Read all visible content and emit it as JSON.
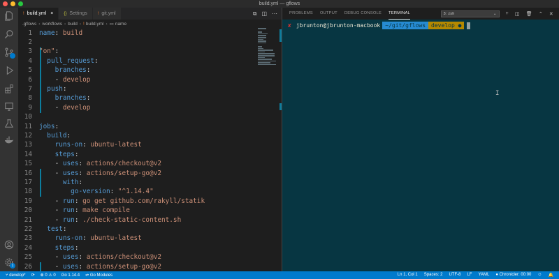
{
  "window": {
    "title": "build.yml — gflows"
  },
  "tabs": [
    {
      "icon": "!",
      "label": "build.yml",
      "active": true,
      "close": "×"
    },
    {
      "icon": "{}",
      "label": "Settings",
      "active": false,
      "close": ""
    },
    {
      "icon": "!",
      "label": "git.yml",
      "active": false,
      "close": ""
    }
  ],
  "breadcrumb": [
    ".gflows",
    "workflows",
    "build",
    "build.yml",
    "name"
  ],
  "editor": {
    "lines": [
      {
        "n": "1",
        "text": "name: build"
      },
      {
        "n": "2",
        "text": ""
      },
      {
        "n": "3",
        "text": "\"on\":"
      },
      {
        "n": "4",
        "text": "  pull_request:"
      },
      {
        "n": "5",
        "text": "    branches:"
      },
      {
        "n": "6",
        "text": "    - develop"
      },
      {
        "n": "7",
        "text": "  push:"
      },
      {
        "n": "8",
        "text": "    branches:"
      },
      {
        "n": "9",
        "text": "    - develop"
      },
      {
        "n": "10",
        "text": ""
      },
      {
        "n": "11",
        "text": "jobs:"
      },
      {
        "n": "12",
        "text": "  build:"
      },
      {
        "n": "13",
        "text": "    runs-on: ubuntu-latest"
      },
      {
        "n": "14",
        "text": "    steps:"
      },
      {
        "n": "15",
        "text": "    - uses: actions/checkout@v2"
      },
      {
        "n": "16",
        "text": "    - uses: actions/setup-go@v2"
      },
      {
        "n": "17",
        "text": "      with:"
      },
      {
        "n": "18",
        "text": "        go-version: \"^1.14.4\""
      },
      {
        "n": "19",
        "text": "    - run: go get github.com/rakyll/statik"
      },
      {
        "n": "20",
        "text": "    - run: make compile"
      },
      {
        "n": "21",
        "text": "    - run: ./check-static-content.sh"
      },
      {
        "n": "22",
        "text": "  test:"
      },
      {
        "n": "23",
        "text": "    runs-on: ubuntu-latest"
      },
      {
        "n": "24",
        "text": "    steps:"
      },
      {
        "n": "25",
        "text": "    - uses: actions/checkout@v2"
      },
      {
        "n": "26",
        "text": "    - uses: actions/setup-go@v2"
      }
    ]
  },
  "panel": {
    "tabs": [
      "PROBLEMS",
      "OUTPUT",
      "DEBUG CONSOLE",
      "TERMINAL"
    ],
    "active_tab": "TERMINAL",
    "terminal_select": "3: zsh"
  },
  "terminal": {
    "status_symbol": "✘",
    "user": "jbrunton@jbrunton-macbook",
    "path": "~/git/gflows",
    "branch": " develop ●",
    "colors": {
      "background": "#073642",
      "path": "#268bd2",
      "branch": "#b58900",
      "error": "#dc322f"
    }
  },
  "statusbar": {
    "branch": "develop*",
    "problems": "⊗ 0 ⚠ 0",
    "go_version": "Go 1.14.4",
    "go_modules": "Go Modules",
    "position": "Ln 1, Col 1",
    "spaces": "Spaces: 2",
    "encoding": "UTF-8",
    "eol": "LF",
    "language": "YAML",
    "chronicler": "Chronicler: 00:00",
    "color": "#007acc"
  },
  "activity_bar": {
    "icons": [
      "files-icon",
      "search-icon",
      "source-control-icon",
      "run-debug-icon",
      "extensions-icon",
      "remote-explorer-icon",
      "test-icon",
      "docker-icon",
      "account-icon",
      "settings-gear-icon"
    ],
    "settings_badge": "1"
  }
}
